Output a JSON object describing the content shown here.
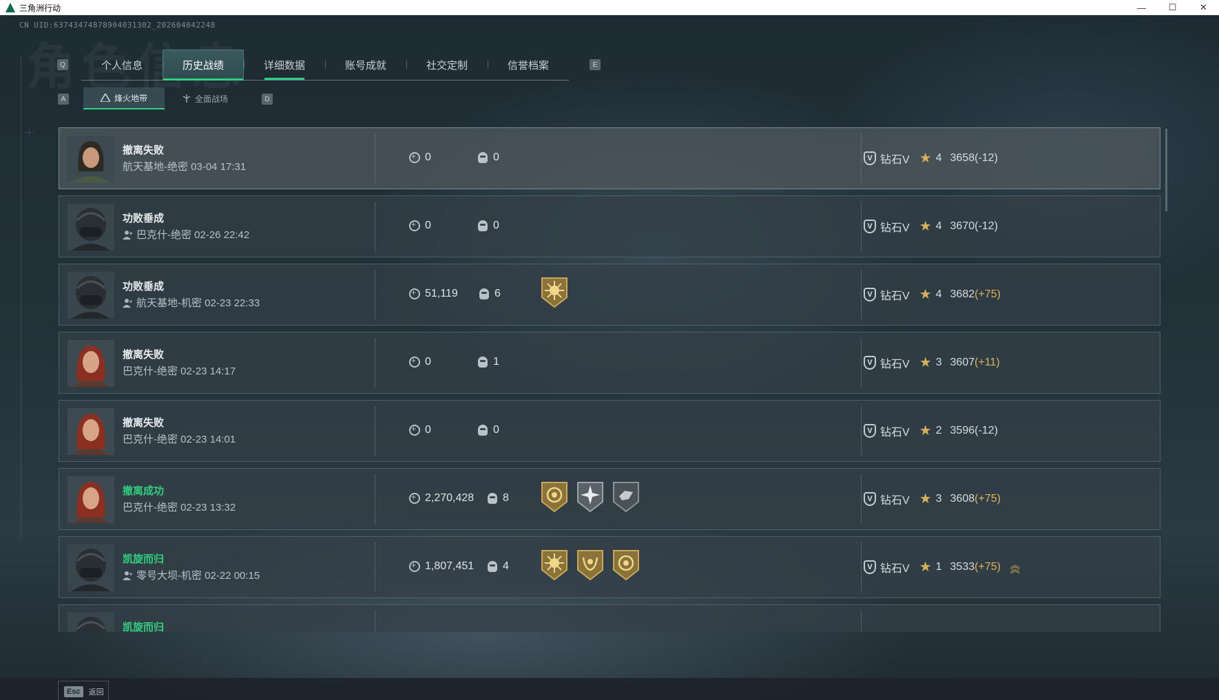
{
  "window": {
    "title": "三角洲行动",
    "controls": [
      "—",
      "☐",
      "✕"
    ]
  },
  "header": {
    "uid": "CN UID:6374347487890403130​2_202604042248",
    "watermark": "角色信息"
  },
  "key_hints": {
    "prev_tab": "Q",
    "next_tab": "E",
    "prev_sub": "A",
    "next_sub": "D"
  },
  "tabs": [
    {
      "label": "个人信息"
    },
    {
      "label": "历史战绩"
    },
    {
      "label": "详细数据"
    },
    {
      "label": "账号成就"
    },
    {
      "label": "社交定制"
    },
    {
      "label": "信誉档案"
    }
  ],
  "subtabs": [
    {
      "label": "烽火地带"
    },
    {
      "label": "全面战场"
    }
  ],
  "records": [
    {
      "result": "撤离失败",
      "success": false,
      "map": "航天基地-绝密 03-04 17:31",
      "has_map_icon": false,
      "money": "0",
      "kills": "0",
      "badges": [],
      "rank": "钻石V",
      "stars": "4",
      "score": "3658",
      "delta": "(-12)",
      "delta_positive": false,
      "avatar": "female-dark",
      "promoted": false
    },
    {
      "result": "功败垂成",
      "success": false,
      "map": "巴克什-绝密 02-26 22:42",
      "has_map_icon": true,
      "money": "0",
      "kills": "0",
      "badges": [],
      "rank": "钻石V",
      "stars": "4",
      "score": "3670",
      "delta": "(-12)",
      "delta_positive": false,
      "avatar": "helmet",
      "promoted": false
    },
    {
      "result": "功败垂成",
      "success": false,
      "map": "航天基地-机密 02-23 22:33",
      "has_map_icon": true,
      "money": "51,119",
      "kills": "6",
      "badges": [
        "sun-badge"
      ],
      "rank": "钻石V",
      "stars": "4",
      "score": "3682",
      "delta": "(+75)",
      "delta_positive": true,
      "avatar": "helmet",
      "promoted": false
    },
    {
      "result": "撤离失败",
      "success": false,
      "map": "巴克什-绝密 02-23 14:17",
      "has_map_icon": false,
      "money": "0",
      "kills": "1",
      "badges": [],
      "rank": "钻石V",
      "stars": "3",
      "score": "3607",
      "delta": "(+11)",
      "delta_positive": true,
      "avatar": "female-red",
      "promoted": false
    },
    {
      "result": "撤离失败",
      "success": false,
      "map": "巴克什-绝密 02-23 14:01",
      "has_map_icon": false,
      "money": "0",
      "kills": "0",
      "badges": [],
      "rank": "钻石V",
      "stars": "2",
      "score": "3596",
      "delta": "(-12)",
      "delta_positive": false,
      "avatar": "female-red",
      "promoted": false
    },
    {
      "result": "撤离成功",
      "success": true,
      "map": "巴克什-绝密 02-23 13:32",
      "has_map_icon": false,
      "money": "2,270,428",
      "kills": "8",
      "badges": [
        "coin-badge",
        "burst-badge",
        "shield-badge"
      ],
      "rank": "钻石V",
      "stars": "3",
      "score": "3608",
      "delta": "(+75)",
      "delta_positive": true,
      "avatar": "female-red",
      "promoted": false
    },
    {
      "result": "凯旋而归",
      "success": true,
      "map": "零号大坝-机密 02-22 00:15",
      "has_map_icon": true,
      "money": "1,807,451",
      "kills": "4",
      "badges": [
        "sun-badge",
        "laurel-badge",
        "coin-badge"
      ],
      "rank": "钻石V",
      "stars": "1",
      "score": "3533",
      "delta": "(+75)",
      "delta_positive": true,
      "avatar": "helmet",
      "promoted": true
    },
    {
      "result": "凯旋而归",
      "success": true,
      "map": "",
      "has_map_icon": false,
      "money": "",
      "kills": "",
      "badges": [],
      "rank": "",
      "stars": "",
      "score": "",
      "delta": "",
      "delta_positive": true,
      "avatar": "helmet",
      "promoted": false
    }
  ],
  "footer": {
    "esc_key": "Esc",
    "back_label": "返回"
  },
  "colors": {
    "accent": "#2fd07f",
    "gold": "#e0b45a"
  }
}
